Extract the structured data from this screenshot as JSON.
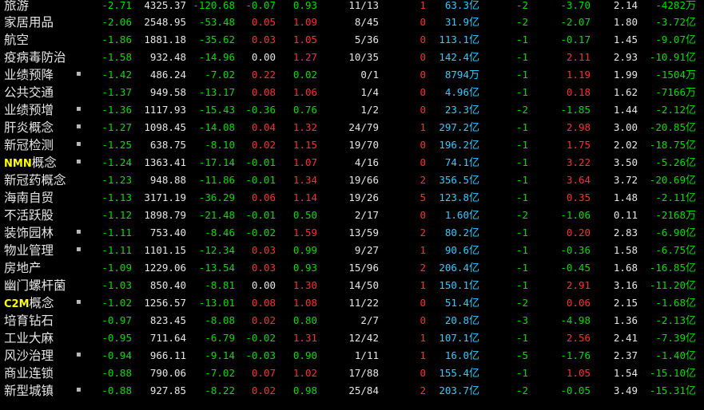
{
  "colors": {
    "up": "#ff3030",
    "down": "#00dd00",
    "flat": "#e6e6e6",
    "volume": "#33ccff",
    "background": "#000000"
  },
  "rows": [
    {
      "name": "旅游",
      "dot": "",
      "c1": "-2.71",
      "c2": "4325.37",
      "c3": "-120.68",
      "c4": "-0.07",
      "c5": "0.93",
      "c6": "11/13",
      "c7": "1",
      "c8": "63.3",
      "c8u": "亿",
      "c9": "-2",
      "c10": "-3.70",
      "c11": "2.14",
      "c12": "-4282",
      "c12u": "万",
      "s1": "green",
      "s3": "green",
      "s4": "green",
      "s5": "green",
      "s10": "green"
    },
    {
      "name": "家居用品",
      "dot": "",
      "c1": "-2.06",
      "c2": "2548.95",
      "c3": "-53.48",
      "c4": "0.05",
      "c5": "1.09",
      "c6": "8/45",
      "c7": "0",
      "c8": "31.9",
      "c8u": "亿",
      "c9": "-2",
      "c10": "-2.07",
      "c11": "1.80",
      "c12": "-3.72",
      "c12u": "亿",
      "s1": "green",
      "s3": "green",
      "s4": "red",
      "s5": "red",
      "s10": "green"
    },
    {
      "name": "航空",
      "dot": "",
      "c1": "-1.86",
      "c2": "1881.18",
      "c3": "-35.62",
      "c4": "0.03",
      "c5": "1.05",
      "c6": "5/36",
      "c7": "0",
      "c8": "113.1",
      "c8u": "亿",
      "c9": "-1",
      "c10": "-0.17",
      "c11": "1.45",
      "c12": "-9.07",
      "c12u": "亿",
      "s1": "green",
      "s3": "green",
      "s4": "red",
      "s5": "red",
      "s10": "green"
    },
    {
      "name": "疫病毒防治",
      "dot": "",
      "c1": "-1.58",
      "c2": "932.48",
      "c3": "-14.96",
      "c4": "0.00",
      "c5": "1.27",
      "c6": "10/35",
      "c7": "0",
      "c8": "142.4",
      "c8u": "亿",
      "c9": "-1",
      "c10": "2.11",
      "c11": "2.93",
      "c12": "-10.91",
      "c12u": "亿",
      "s1": "green",
      "s3": "green",
      "s4": "white",
      "s5": "red",
      "s10": "red"
    },
    {
      "name": "业绩预降",
      "dot": "▪",
      "c1": "-1.42",
      "c2": "486.24",
      "c3": "-7.02",
      "c4": "0.22",
      "c5": "0.02",
      "c6": "0/1",
      "c7": "0",
      "c8": "8794",
      "c8u": "万",
      "c9": "-1",
      "c10": "1.19",
      "c11": "1.99",
      "c12": "-1504",
      "c12u": "万",
      "s1": "green",
      "s3": "green",
      "s4": "red",
      "s5": "green",
      "s10": "red"
    },
    {
      "name": "公共交通",
      "dot": "",
      "c1": "-1.37",
      "c2": "949.58",
      "c3": "-13.17",
      "c4": "0.08",
      "c5": "1.06",
      "c6": "1/4",
      "c7": "0",
      "c8": "4.96",
      "c8u": "亿",
      "c9": "-1",
      "c10": "0.18",
      "c11": "1.62",
      "c12": "-7166",
      "c12u": "万",
      "s1": "green",
      "s3": "green",
      "s4": "red",
      "s5": "red",
      "s10": "red"
    },
    {
      "name": "业绩预增",
      "dot": "▪",
      "c1": "-1.36",
      "c2": "1117.93",
      "c3": "-15.43",
      "c4": "-0.36",
      "c5": "0.76",
      "c6": "1/2",
      "c7": "0",
      "c8": "23.3",
      "c8u": "亿",
      "c9": "-2",
      "c10": "-1.85",
      "c11": "1.44",
      "c12": "-2.12",
      "c12u": "亿",
      "s1": "green",
      "s3": "green",
      "s4": "green",
      "s5": "green",
      "s10": "green"
    },
    {
      "name": "肝炎概念",
      "dot": "▪",
      "c1": "-1.27",
      "c2": "1098.45",
      "c3": "-14.08",
      "c4": "0.04",
      "c5": "1.32",
      "c6": "24/79",
      "c7": "1",
      "c8": "297.2",
      "c8u": "亿",
      "c9": "-1",
      "c10": "2.98",
      "c11": "3.00",
      "c12": "-20.85",
      "c12u": "亿",
      "s1": "green",
      "s3": "green",
      "s4": "red",
      "s5": "red",
      "s10": "red"
    },
    {
      "name": "新冠检测",
      "dot": "▪",
      "c1": "-1.25",
      "c2": "638.75",
      "c3": "-8.10",
      "c4": "0.02",
      "c5": "1.15",
      "c6": "19/70",
      "c7": "0",
      "c8": "196.2",
      "c8u": "亿",
      "c9": "-1",
      "c10": "1.75",
      "c11": "2.02",
      "c12": "-18.75",
      "c12u": "亿",
      "s1": "green",
      "s3": "green",
      "s4": "red",
      "s5": "red",
      "s10": "red"
    },
    {
      "name": "NMN概念",
      "latin": "NMN",
      "rest": "概念",
      "dot": "▪",
      "c1": "-1.24",
      "c2": "1363.41",
      "c3": "-17.14",
      "c4": "-0.01",
      "c5": "1.07",
      "c6": "4/16",
      "c7": "0",
      "c8": "74.1",
      "c8u": "亿",
      "c9": "-1",
      "c10": "3.22",
      "c11": "3.50",
      "c12": "-5.26",
      "c12u": "亿",
      "s1": "green",
      "s3": "green",
      "s4": "green",
      "s5": "red",
      "s10": "red"
    },
    {
      "name": "新冠药概念",
      "dot": "",
      "c1": "-1.23",
      "c2": "948.88",
      "c3": "-11.86",
      "c4": "-0.01",
      "c5": "1.34",
      "c6": "19/66",
      "c7": "2",
      "c8": "356.5",
      "c8u": "亿",
      "c9": "-1",
      "c10": "3.64",
      "c11": "3.72",
      "c12": "-20.69",
      "c12u": "亿",
      "s1": "green",
      "s3": "green",
      "s4": "green",
      "s5": "red",
      "s10": "red"
    },
    {
      "name": "海南自贸",
      "dot": "",
      "c1": "-1.13",
      "c2": "3171.19",
      "c3": "-36.29",
      "c4": "0.06",
      "c5": "1.14",
      "c6": "19/26",
      "c7": "5",
      "c8": "123.8",
      "c8u": "亿",
      "c9": "-1",
      "c10": "0.35",
      "c11": "1.48",
      "c12": "-2.11",
      "c12u": "亿",
      "s1": "green",
      "s3": "green",
      "s4": "red",
      "s5": "red",
      "s10": "red"
    },
    {
      "name": "不活跃股",
      "dot": "",
      "c1": "-1.12",
      "c2": "1898.79",
      "c3": "-21.48",
      "c4": "-0.01",
      "c5": "0.50",
      "c6": "2/17",
      "c7": "0",
      "c8": "1.60",
      "c8u": "亿",
      "c9": "-2",
      "c10": "-1.06",
      "c11": "0.11",
      "c12": "-2168",
      "c12u": "万",
      "s1": "green",
      "s3": "green",
      "s4": "green",
      "s5": "green",
      "s10": "green"
    },
    {
      "name": "装饰园林",
      "dot": "▪",
      "c1": "-1.11",
      "c2": "753.40",
      "c3": "-8.46",
      "c4": "-0.02",
      "c5": "1.59",
      "c6": "13/59",
      "c7": "2",
      "c8": "80.2",
      "c8u": "亿",
      "c9": "-1",
      "c10": "0.20",
      "c11": "2.83",
      "c12": "-6.90",
      "c12u": "亿",
      "s1": "green",
      "s3": "green",
      "s4": "green",
      "s5": "red",
      "s10": "red"
    },
    {
      "name": "物业管理",
      "dot": "▪",
      "c1": "-1.11",
      "c2": "1101.15",
      "c3": "-12.34",
      "c4": "0.03",
      "c5": "0.99",
      "c6": "9/27",
      "c7": "1",
      "c8": "90.6",
      "c8u": "亿",
      "c9": "-1",
      "c10": "-0.36",
      "c11": "1.58",
      "c12": "-6.75",
      "c12u": "亿",
      "s1": "green",
      "s3": "green",
      "s4": "red",
      "s5": "green",
      "s10": "green"
    },
    {
      "name": "房地产",
      "dot": "",
      "c1": "-1.09",
      "c2": "1229.06",
      "c3": "-13.54",
      "c4": "0.03",
      "c5": "0.93",
      "c6": "15/96",
      "c7": "2",
      "c8": "206.4",
      "c8u": "亿",
      "c9": "-1",
      "c10": "-0.45",
      "c11": "1.68",
      "c12": "-16.85",
      "c12u": "亿",
      "s1": "green",
      "s3": "green",
      "s4": "red",
      "s5": "green",
      "s10": "green"
    },
    {
      "name": "幽门螺杆菌",
      "dot": "",
      "c1": "-1.03",
      "c2": "850.40",
      "c3": "-8.81",
      "c4": "0.00",
      "c5": "1.30",
      "c6": "14/50",
      "c7": "1",
      "c8": "150.1",
      "c8u": "亿",
      "c9": "-1",
      "c10": "2.91",
      "c11": "3.16",
      "c12": "-11.20",
      "c12u": "亿",
      "s1": "green",
      "s3": "green",
      "s4": "white",
      "s5": "red",
      "s10": "red"
    },
    {
      "name": "C2M概念",
      "latin": "C2M",
      "rest": "概念",
      "dot": "▪",
      "c1": "-1.02",
      "c2": "1256.57",
      "c3": "-13.01",
      "c4": "0.08",
      "c5": "1.08",
      "c6": "11/22",
      "c7": "0",
      "c8": "51.4",
      "c8u": "亿",
      "c9": "-2",
      "c10": "0.06",
      "c11": "2.15",
      "c12": "-1.68",
      "c12u": "亿",
      "s1": "green",
      "s3": "green",
      "s4": "red",
      "s5": "red",
      "s10": "red"
    },
    {
      "name": "培育钻石",
      "dot": "",
      "c1": "-0.97",
      "c2": "823.45",
      "c3": "-8.08",
      "c4": "0.02",
      "c5": "0.80",
      "c6": "2/7",
      "c7": "0",
      "c8": "20.8",
      "c8u": "亿",
      "c9": "-3",
      "c10": "-4.98",
      "c11": "1.36",
      "c12": "-2.13",
      "c12u": "亿",
      "s1": "green",
      "s3": "green",
      "s4": "red",
      "s5": "green",
      "s10": "green"
    },
    {
      "name": "工业大麻",
      "dot": "",
      "c1": "-0.95",
      "c2": "711.64",
      "c3": "-6.79",
      "c4": "-0.02",
      "c5": "1.31",
      "c6": "12/42",
      "c7": "1",
      "c8": "107.1",
      "c8u": "亿",
      "c9": "-1",
      "c10": "2.56",
      "c11": "2.41",
      "c12": "-7.39",
      "c12u": "亿",
      "s1": "green",
      "s3": "green",
      "s4": "green",
      "s5": "red",
      "s10": "red"
    },
    {
      "name": "风沙治理",
      "dot": "▪",
      "c1": "-0.94",
      "c2": "966.11",
      "c3": "-9.14",
      "c4": "-0.03",
      "c5": "0.90",
      "c6": "1/11",
      "c7": "1",
      "c8": "16.0",
      "c8u": "亿",
      "c9": "-5",
      "c10": "-1.76",
      "c11": "2.37",
      "c12": "-1.40",
      "c12u": "亿",
      "s1": "green",
      "s3": "green",
      "s4": "green",
      "s5": "green",
      "s10": "green"
    },
    {
      "name": "商业连锁",
      "dot": "",
      "c1": "-0.88",
      "c2": "790.06",
      "c3": "-7.02",
      "c4": "0.07",
      "c5": "1.02",
      "c6": "17/88",
      "c7": "0",
      "c8": "155.4",
      "c8u": "亿",
      "c9": "-1",
      "c10": "1.05",
      "c11": "1.54",
      "c12": "-15.10",
      "c12u": "亿",
      "s1": "green",
      "s3": "green",
      "s4": "red",
      "s5": "red",
      "s10": "red"
    },
    {
      "name": "新型城镇",
      "dot": "▪",
      "c1": "-0.88",
      "c2": "927.85",
      "c3": "-8.22",
      "c4": "0.02",
      "c5": "0.98",
      "c6": "25/84",
      "c7": "2",
      "c8": "203.7",
      "c8u": "亿",
      "c9": "-2",
      "c10": "-0.05",
      "c11": "3.49",
      "c12": "-15.31",
      "c12u": "亿",
      "s1": "green",
      "s3": "green",
      "s4": "red",
      "s5": "green",
      "s10": "green"
    }
  ]
}
